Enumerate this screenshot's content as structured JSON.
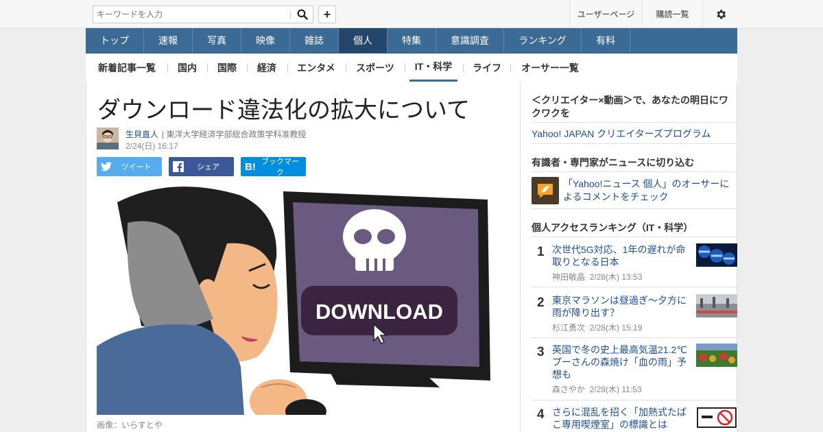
{
  "header": {
    "search_placeholder": "キーワードを入力",
    "add_label": "+",
    "user_page": "ユーザーページ",
    "subscriptions": "購読一覧"
  },
  "main_nav": [
    {
      "label": "トップ"
    },
    {
      "label": "速報"
    },
    {
      "label": "写真"
    },
    {
      "label": "映像"
    },
    {
      "label": "雑誌"
    },
    {
      "label": "個人",
      "active": true
    },
    {
      "label": "特集"
    },
    {
      "label": "意識調査"
    },
    {
      "label": "ランキング"
    },
    {
      "label": "有料"
    }
  ],
  "sub_nav": [
    {
      "label": "新着記事一覧"
    },
    {
      "label": "国内"
    },
    {
      "label": "国際"
    },
    {
      "label": "経済"
    },
    {
      "label": "エンタメ"
    },
    {
      "label": "スポーツ"
    },
    {
      "label": "IT・科学",
      "active": true
    },
    {
      "label": "ライフ"
    },
    {
      "label": "オーサー一覧"
    }
  ],
  "article": {
    "title": "ダウンロード違法化の拡大について",
    "author_name": "生貝直人",
    "author_role": "| 東洋大学経済学部総合政策学科准教授",
    "date": "2/24(日) 16:17",
    "share_tweet": "ツイート",
    "share_facebook": "シェア",
    "share_hatena": "ブックマーク",
    "image_text": "DOWNLOAD",
    "caption": "画像：いらすとや"
  },
  "sidebar": {
    "creators_heading": "＜クリエイター×動画＞で、あなたの明日にワクワクを",
    "creators_link": "Yahoo! JAPAN クリエイターズプログラム",
    "experts_heading": "有識者・専門家がニュースに切り込む",
    "experts_link": "「Yahoo!ニュース 個人」のオーサーによるコメントをチェック",
    "ranking_heading": "個人アクセスランキング（IT・科学）",
    "ranking": [
      {
        "rank": "1",
        "title": "次世代5G対応、1年の遅れが命取りとなる日本",
        "author": "神田敏晶",
        "date": "2/28(木) 13:53"
      },
      {
        "rank": "2",
        "title": "東京マラソンは昼過ぎ～夕方に雨が降り出す？",
        "author": "杉江勇次",
        "date": "2/28(木) 15:19"
      },
      {
        "rank": "3",
        "title": "英国で冬の史上最高気温21.2℃　プーさんの森焼け「血の雨」予想も",
        "author": "森さやか",
        "date": "2/28(木) 11:53"
      },
      {
        "rank": "4",
        "title": "さらに混乱を招く「加熱式たばこ専用喫煙室」の標識とは",
        "author": "",
        "date": ""
      }
    ]
  },
  "colors": {
    "nav_bg": "#3b6a95",
    "nav_active": "#23466a",
    "link": "#1a4fa0",
    "twitter": "#55acee",
    "facebook": "#3b5998",
    "hatena": "#008fde"
  }
}
